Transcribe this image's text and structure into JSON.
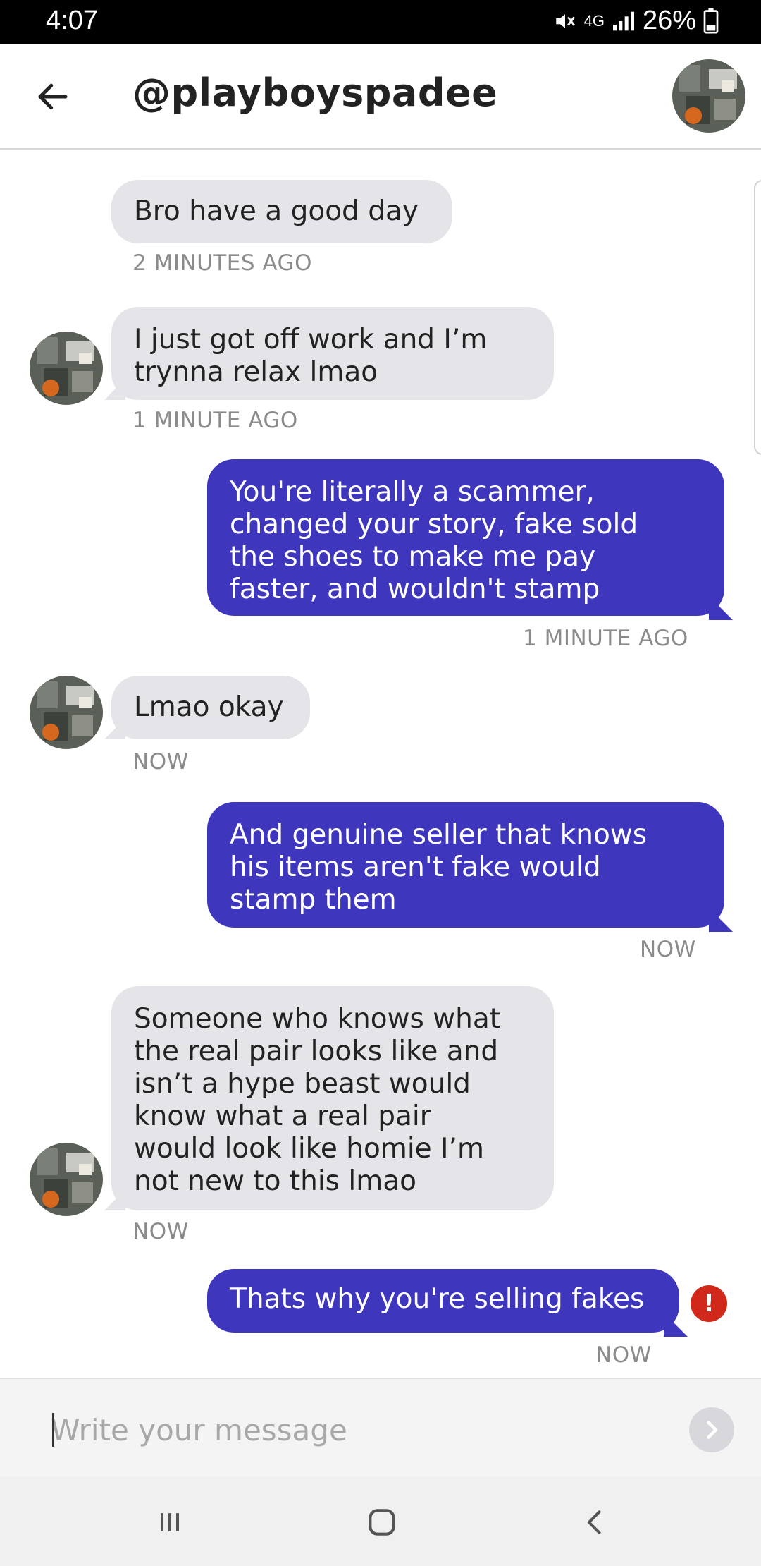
{
  "status_bar": {
    "time": "4:07",
    "network": "4G",
    "battery": "26%"
  },
  "header": {
    "title": "@playboyspadee"
  },
  "composer": {
    "placeholder": "Write your message"
  },
  "messages": [
    {
      "from": "them",
      "lines": [
        "Bro have a good day"
      ],
      "time": "2 MINUTES AGO"
    },
    {
      "from": "them",
      "lines": [
        "I just got off work and I’m",
        "trynna relax lmao"
      ],
      "time": "1 MINUTE AGO"
    },
    {
      "from": "me",
      "lines": [
        "You're literally a scammer,",
        "changed your story, fake sold",
        "the shoes to make me pay",
        "faster, and wouldn't stamp"
      ],
      "time": "1 MINUTE AGO"
    },
    {
      "from": "them",
      "lines": [
        "Lmao okay"
      ],
      "time": "NOW"
    },
    {
      "from": "me",
      "lines": [
        "And genuine seller that knows",
        "his items aren't fake would",
        "stamp them"
      ],
      "time": "NOW"
    },
    {
      "from": "them",
      "lines": [
        "Someone who knows what",
        "the real pair looks like and",
        "isn’t a hype beast would",
        "know what a real pair",
        "would look like homie I’m",
        "not new to this lmao"
      ],
      "time": "NOW"
    },
    {
      "from": "me",
      "lines": [
        "Thats why you're selling fakes"
      ],
      "time": "NOW",
      "status": "!"
    }
  ],
  "icons": {
    "back": "arrow-left-icon",
    "send": "chevron-right-icon",
    "error": "error-icon",
    "nav_recent": "recent-apps-icon",
    "nav_home": "home-icon",
    "nav_back": "back-icon"
  },
  "colors": {
    "outgoing": "#3e37bd",
    "incoming": "#e4e4e9",
    "error": "#d0291c"
  }
}
